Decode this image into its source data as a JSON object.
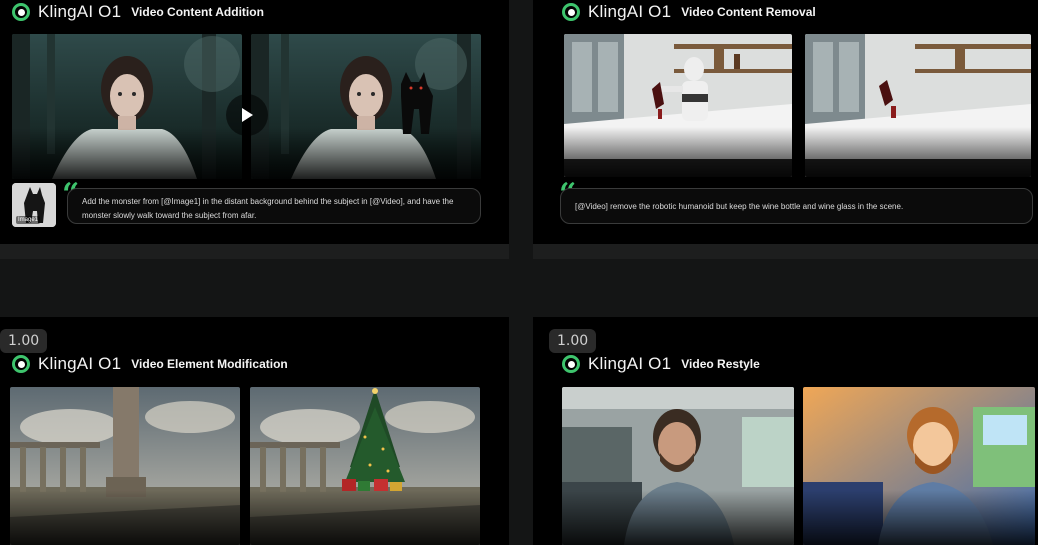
{
  "brand": "KlingAI O1",
  "zoom": "1.00",
  "cards": [
    {
      "feature": "Video Content Addition",
      "prompt": "Add the monster from [@Image1] in the distant background behind the subject in [@Video], and have the monster slowly walk toward the subject from afar.",
      "thumb_label": "Image1"
    },
    {
      "feature": "Video Content Removal",
      "prompt": "[@Video] remove the robotic humanoid but keep the wine bottle and wine glass in the scene."
    },
    {
      "feature": "Video Element Modification"
    },
    {
      "feature": "Video Restyle"
    }
  ]
}
